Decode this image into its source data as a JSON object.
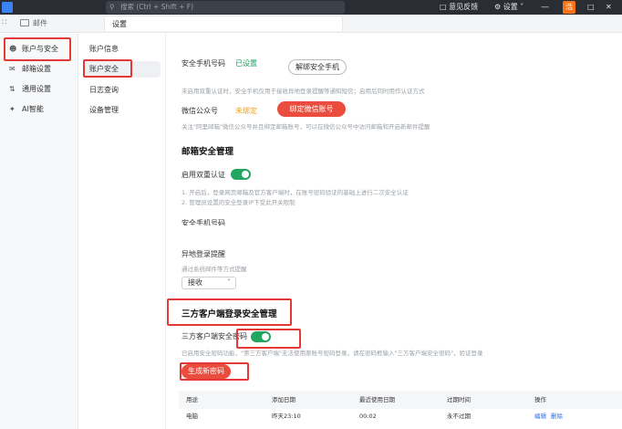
{
  "topbar": {
    "search_placeholder": "搜索 (Ctrl + Shift + F)",
    "feedback": "意见反馈",
    "settings": "设置",
    "avatar_letter": "浩"
  },
  "subbar": {
    "mail_label": "邮件",
    "active_tab": "设置"
  },
  "sidebar": {
    "items": [
      {
        "label": "账户与安全",
        "icon": "user-icon"
      },
      {
        "label": "邮箱设置",
        "icon": "mailbox-icon"
      },
      {
        "label": "通用设置",
        "icon": "sliders-icon"
      },
      {
        "label": "AI智能",
        "icon": "sparkle-icon"
      }
    ]
  },
  "second_nav": {
    "items": [
      "账户信息",
      "账户安全",
      "日志查询",
      "设备管理"
    ]
  },
  "main": {
    "phone_label": "安全手机号码",
    "phone_status": "已设置",
    "unbind_phone": "解绑安全手机",
    "phone_hint": "未启用双重认证时，安全手机仅用于接收异地登录提醒等通知短信；启用后同时用作认证方式",
    "wechat_label": "微信公众号",
    "wechat_status": "未绑定",
    "bind_wechat": "绑定微信账号",
    "wechat_hint": "关注\"阿里邮箱\"微信公众号并且绑定邮箱账号，可以在微信公众号中访问邮箱和开启新邮件提醒",
    "mailbox_security_title": "邮箱安全管理",
    "two_factor_label": "启用双重认证",
    "two_factor_on": true,
    "note1": "1. 开启后，登录网页邮箱及官方客户端时，在账号密码验证的基础上进行二次安全认证",
    "note2": "2. 管理员设置的安全登录IP下受此开关限制",
    "phone_label_cut": "安全手机号码",
    "remote_login_label": "异地登录提醒",
    "remote_login_hint": "通过系统邮件等方式提醒",
    "remote_select_value": "接收",
    "third_party_title": "三方客户端登录安全管理",
    "third_party_pwd_label": "三方客户端安全密码",
    "third_party_on": true,
    "third_party_hint": "已启用安全密码功能，\"第三方客户端\"无法使用原账号密码登录，请在密码框输入\"三方客户端安全密码\"，验证登录",
    "generate_pwd": "生成新密码"
  },
  "table": {
    "headers": [
      "用途",
      "添加日期",
      "最近使用日期",
      "过期时间",
      "操作"
    ],
    "rows": [
      {
        "usage": "电脑",
        "added": "昨天23:10",
        "last_used": "00:02",
        "expires": "永不过期",
        "edit": "编辑",
        "delete": "删除"
      }
    ]
  },
  "colors": {
    "accent_red": "#ea4c3d",
    "toggle_green": "#22a560",
    "highlight_box": "#e53935",
    "topbar_bg": "#2a2d34"
  }
}
